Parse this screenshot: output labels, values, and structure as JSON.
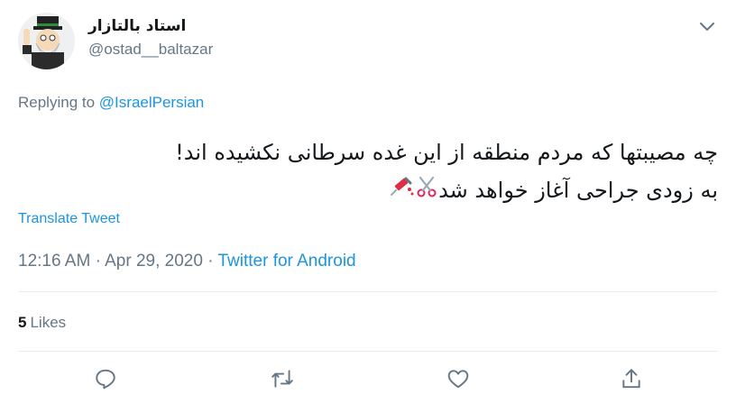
{
  "author": {
    "display_name": "استاد بالتازار",
    "handle": "@ostad__baltazar",
    "avatar_icon": "avatar-character-icon"
  },
  "replying": {
    "prefix": "Replying to",
    "to": "@IsraelPersian"
  },
  "tweet": {
    "line1": "چه مصیبتها که مردم منطقه از این غده سرطانی نکشیده اند!",
    "line2": "به زودی جراحی آغاز خواهد شد",
    "emojis": [
      "scissors-emoji",
      "syringe-emoji"
    ]
  },
  "translate_label": "Translate Tweet",
  "meta": {
    "time": "12:16 AM",
    "sep1": "·",
    "date": "Apr 29, 2020",
    "sep2": "·",
    "source": "Twitter for Android"
  },
  "likes": {
    "count": "5",
    "label": "Likes"
  },
  "actions": [
    "reply-icon",
    "retweet-icon",
    "like-icon",
    "share-icon"
  ],
  "colors": {
    "link": "#1b95e0",
    "secondary_text": "#657786",
    "primary_text": "#14171a",
    "divider": "#e6ecf0"
  }
}
